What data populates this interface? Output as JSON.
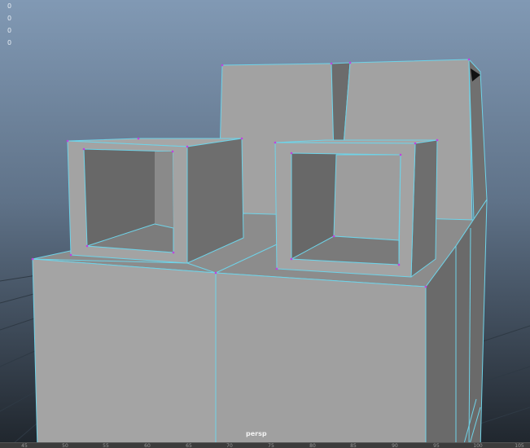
{
  "hud": {
    "values": [
      "0",
      "0",
      "0",
      "0"
    ]
  },
  "camera_label": "persp",
  "timeline": {
    "ticks": [
      "45",
      "50",
      "55",
      "60",
      "65",
      "70",
      "75",
      "80",
      "85",
      "90",
      "95",
      "100",
      "105"
    ]
  },
  "colors": {
    "edge": "#6fd3e8",
    "vertex": "#c040e0",
    "background_top": "#8199b4",
    "background_bottom": "#242b33"
  }
}
